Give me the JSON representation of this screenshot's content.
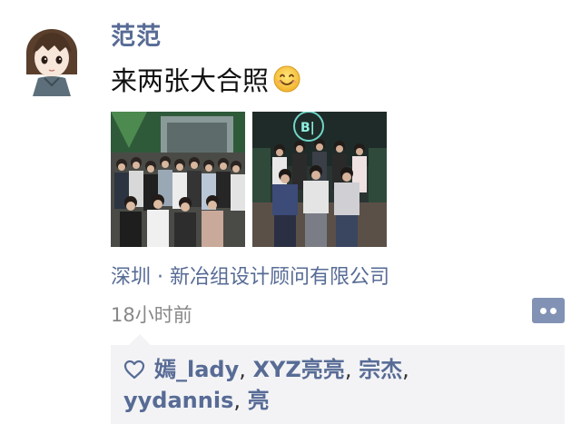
{
  "post": {
    "username": "范范",
    "caption": "来两张大合照",
    "caption_emoji_icon": "smiley-icon",
    "location": "深圳 · 新冶组设计顾问有限公司",
    "time": "18小时前",
    "comment_button_icon": "comment-dots-icon"
  },
  "likes": {
    "icon": "heart-outline-icon",
    "names": [
      "嫣_lady",
      "XYZ亮亮",
      "宗杰",
      "yydannis",
      "亮"
    ],
    "separator": ", "
  },
  "colors": {
    "link": "#576b95",
    "likes_background": "#f3f3f5",
    "comment_button": "#8292b4"
  }
}
